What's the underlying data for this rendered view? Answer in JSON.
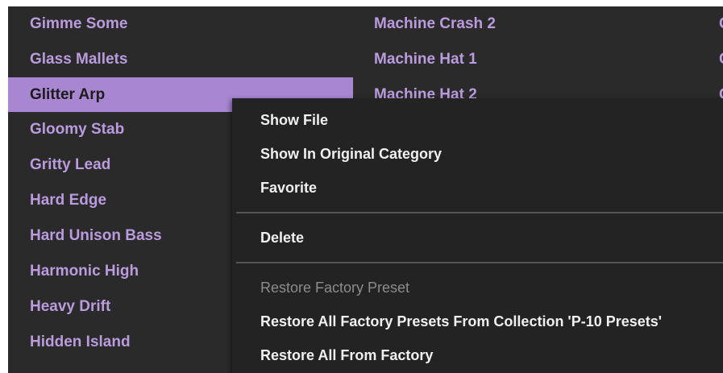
{
  "preset_browser": {
    "column_1": [
      {
        "label": "Gimme Some"
      },
      {
        "label": "Glass Mallets"
      },
      {
        "label": "Glitter Arp"
      },
      {
        "label": "Gloomy Stab"
      },
      {
        "label": "Gritty Lead"
      },
      {
        "label": "Hard Edge"
      },
      {
        "label": "Hard Unison Bass"
      },
      {
        "label": "Harmonic High"
      },
      {
        "label": "Heavy Drift"
      },
      {
        "label": "Hidden Island"
      }
    ],
    "column_2": [
      {
        "label": "Machine Crash 2"
      },
      {
        "label": "Machine Hat 1"
      },
      {
        "label": "Machine Hat 2"
      }
    ],
    "column_3": [
      {
        "label": "C"
      },
      {
        "label": "C"
      },
      {
        "label": "C"
      }
    ],
    "selected_preset": "Glitter Arp"
  },
  "context_menu": {
    "show_file": "Show File",
    "show_in_original_category": "Show In Original Category",
    "favorite": "Favorite",
    "delete": "Delete",
    "restore_factory_preset": "Restore Factory Preset",
    "restore_all_from_collection": "Restore All Factory Presets From Collection 'P-10 Presets'",
    "restore_all_from_factory": "Restore All From Factory"
  },
  "colors": {
    "panel_background": "#2a2a2a",
    "preset_text": "#b99bde",
    "selected_background": "#a886d2",
    "menu_background": "#232323",
    "menu_text": "#f0f0f0",
    "disabled_text": "#8c8c8c"
  }
}
